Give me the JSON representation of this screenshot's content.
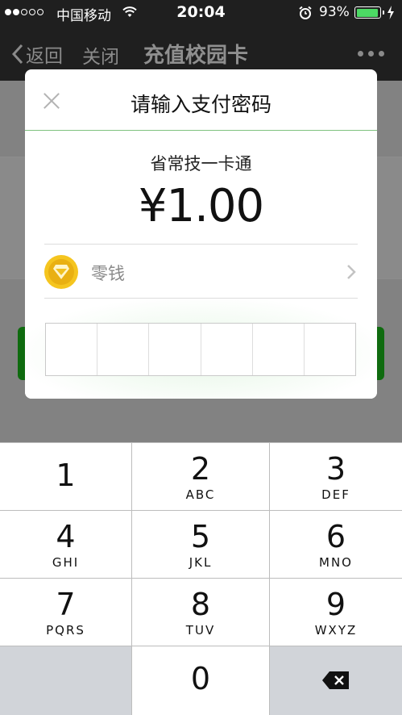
{
  "status_bar": {
    "carrier": "中国移动",
    "time": "20:04",
    "battery_percent": "93%",
    "battery_level": 0.93,
    "icons": [
      "signal-dots-icon",
      "wifi-icon",
      "alarm-clock-icon",
      "battery-icon",
      "charging-bolt-icon"
    ]
  },
  "nav": {
    "back_label": "返回",
    "close_label": "关闭",
    "title": "充值校园卡",
    "more_icon": "more-dots-icon"
  },
  "dialog": {
    "title": "请输入支付密码",
    "close_icon": "close-icon",
    "merchant": "省常技一卡通",
    "amount": "¥1.00",
    "payment_method": {
      "label": "零钱",
      "icon": "change-wallet-coin-icon",
      "chevron_icon": "chevron-right-icon"
    },
    "password_digits": 6
  },
  "keypad": {
    "keys": [
      {
        "num": "1",
        "letters": ""
      },
      {
        "num": "2",
        "letters": "ABC"
      },
      {
        "num": "3",
        "letters": "DEF"
      },
      {
        "num": "4",
        "letters": "GHI"
      },
      {
        "num": "5",
        "letters": "JKL"
      },
      {
        "num": "6",
        "letters": "MNO"
      },
      {
        "num": "7",
        "letters": "PQRS"
      },
      {
        "num": "8",
        "letters": "TUV"
      },
      {
        "num": "9",
        "letters": "WXYZ"
      },
      {
        "num": "0",
        "letters": ""
      }
    ],
    "delete_icon": "backspace-icon"
  },
  "colors": {
    "accent_green": "#0f6b0f",
    "coin_gold": "#f5c51f",
    "battery_green": "#4cd964"
  }
}
